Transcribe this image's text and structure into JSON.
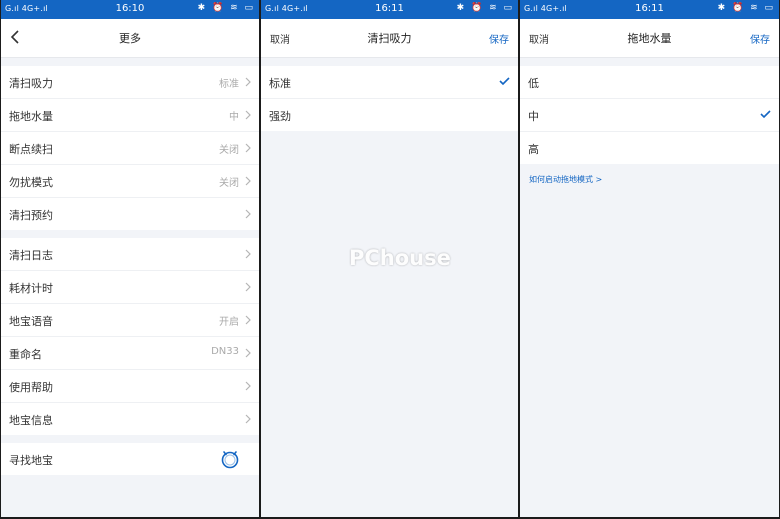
{
  "status_bar": {
    "left": "G.ıl 4G+.ıl",
    "icons": "bluetooth-icon alarm-icon wifi-icon battery-icon",
    "right": "✱ ⏰ ≋ ▭",
    "screens": [
      {
        "time": "16:10"
      },
      {
        "time": "16:11"
      },
      {
        "time": "16:11"
      }
    ]
  },
  "screen_more": {
    "title": "更多",
    "group1": [
      {
        "label": "清扫吸力",
        "value": "标准"
      },
      {
        "label": "拖地水量",
        "value": "中"
      },
      {
        "label": "断点续扫",
        "value": "关闭"
      },
      {
        "label": "勿扰模式",
        "value": "关闭"
      },
      {
        "label": "清扫预约",
        "value": ""
      }
    ],
    "group2": [
      {
        "label": "清扫日志",
        "value": ""
      },
      {
        "label": "耗材计时",
        "value": ""
      },
      {
        "label": "地宝语音",
        "value": "开启"
      },
      {
        "label": "重命名",
        "value": "DN33"
      },
      {
        "label": "使用帮助",
        "value": ""
      },
      {
        "label": "地宝信息",
        "value": ""
      }
    ],
    "group3": [
      {
        "label": "寻找地宝"
      }
    ]
  },
  "screen_suction": {
    "cancel": "取消",
    "title": "清扫吸力",
    "save": "保存",
    "options": [
      {
        "label": "标准",
        "selected": true
      },
      {
        "label": "强劲",
        "selected": false
      }
    ]
  },
  "screen_water": {
    "cancel": "取消",
    "title": "拖地水量",
    "save": "保存",
    "options": [
      {
        "label": "低",
        "selected": false
      },
      {
        "label": "中",
        "selected": true
      },
      {
        "label": "高",
        "selected": false
      }
    ],
    "link": "如何启动拖地模式 >"
  },
  "watermark": "PChouse",
  "colors": {
    "accent": "#1466c3",
    "background": "#f2f4f8",
    "divider": "#eef0f3",
    "value_gray": "#aaaaaa"
  }
}
